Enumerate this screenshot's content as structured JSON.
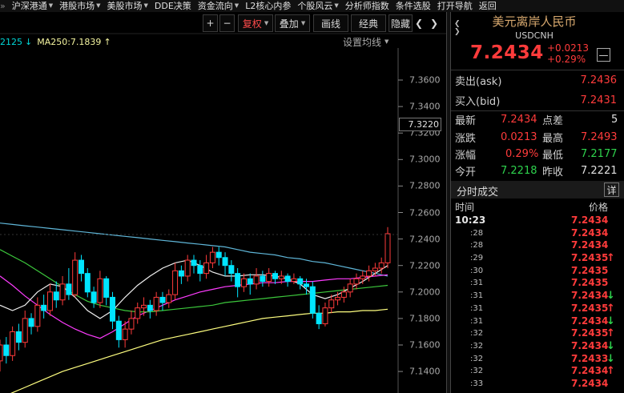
{
  "menu": [
    {
      "label": "沪深港通",
      "dropdown": true
    },
    {
      "label": "港股市场",
      "dropdown": true
    },
    {
      "label": "美股市场",
      "dropdown": true
    },
    {
      "label": "DDE决策",
      "dropdown": false
    },
    {
      "label": "资金流向",
      "dropdown": true
    },
    {
      "label": "L2核心内参",
      "dropdown": false
    },
    {
      "label": "个股风云",
      "dropdown": true
    },
    {
      "label": "分析师指数",
      "dropdown": false
    },
    {
      "label": "条件选股",
      "dropdown": false
    },
    {
      "label": "打开导航",
      "dropdown": false
    },
    {
      "label": "返回",
      "dropdown": false
    }
  ],
  "toolbar": {
    "plus": "+",
    "minus": "−",
    "fuquan": "复权",
    "diejia": "叠加",
    "huaxian": "画线",
    "jingdian": "经典",
    "yincang": "隐藏",
    "prev": "❮",
    "next": "❯"
  },
  "ma_legend": {
    "ma_a": "2125",
    "ma_b": "MA250:7.1839",
    "settings": "设置均线"
  },
  "axis": {
    "ticks": [
      "7.3600",
      "7.3400",
      "7.3200",
      "7.3000",
      "7.2800",
      "7.2600",
      "7.2400",
      "7.2200",
      "7.2000",
      "7.1800",
      "7.1600",
      "7.1400"
    ],
    "current": "7.3220"
  },
  "panel": {
    "title": "美元离岸人民币",
    "code": "USDCNH",
    "price": "7.2434",
    "change": "+0.0213",
    "change_pct": "+0.29%",
    "ask_label": "卖出(ask)",
    "ask": "7.2436",
    "bid_label": "买入(bid)",
    "bid": "7.2431",
    "quote": {
      "latest_label": "最新",
      "latest": "7.2434",
      "spread_label": "点差",
      "spread": "5",
      "change_label": "涨跌",
      "change": "0.0213",
      "high_label": "最高",
      "high": "7.2493",
      "pct_label": "涨幅",
      "pct": "0.29%",
      "low_label": "最低",
      "low": "7.2177",
      "open_label": "今开",
      "open": "7.2218",
      "prev_label": "昨收",
      "prev": "7.2221"
    },
    "trade_title": "分时成交",
    "detail_btn": "详",
    "col_time": "时间",
    "col_price": "价格",
    "trades": [
      {
        "time": "10:23",
        "price": "7.2434",
        "dir": ""
      },
      {
        "time": ":28",
        "price": "7.2434",
        "dir": ""
      },
      {
        "time": ":28",
        "price": "7.2434",
        "dir": ""
      },
      {
        "time": ":29",
        "price": "7.2435",
        "dir": "up"
      },
      {
        "time": ":30",
        "price": "7.2435",
        "dir": ""
      },
      {
        "time": ":31",
        "price": "7.2435",
        "dir": ""
      },
      {
        "time": ":31",
        "price": "7.2434",
        "dir": "down"
      },
      {
        "time": ":31",
        "price": "7.2435",
        "dir": "up"
      },
      {
        "time": ":31",
        "price": "7.2434",
        "dir": "down"
      },
      {
        "time": ":32",
        "price": "7.2435",
        "dir": "up"
      },
      {
        "time": ":32",
        "price": "7.2434",
        "dir": "down"
      },
      {
        "time": ":32",
        "price": "7.2433",
        "dir": "down"
      },
      {
        "time": ":32",
        "price": "7.2434",
        "dir": "up"
      },
      {
        "time": ":33",
        "price": "7.2434",
        "dir": ""
      }
    ]
  },
  "colors": {
    "up": "#ff3b3b",
    "down": "#00e5ff",
    "ma_cyan": "#5fb6d8",
    "ma_yellow": "#ffff80",
    "ma_magenta": "#ff3cff",
    "ma_green": "#3cc83c",
    "ma_white": "#f0f0f0"
  },
  "chart_data": {
    "type": "candlestick",
    "ylim": [
      7.13,
      7.37
    ],
    "candles": [
      [
        7.148,
        7.16,
        7.14,
        7.164
      ],
      [
        7.16,
        7.152,
        7.146,
        7.166
      ],
      [
        7.152,
        7.17,
        7.148,
        7.174
      ],
      [
        7.17,
        7.162,
        7.156,
        7.176
      ],
      [
        7.162,
        7.18,
        7.158,
        7.186
      ],
      [
        7.18,
        7.174,
        7.168,
        7.184
      ],
      [
        7.174,
        7.19,
        7.17,
        7.196
      ],
      [
        7.19,
        7.186,
        7.18,
        7.198
      ],
      [
        7.186,
        7.2,
        7.182,
        7.206
      ],
      [
        7.2,
        7.194,
        7.188,
        7.208
      ],
      [
        7.194,
        7.206,
        7.19,
        7.212
      ],
      [
        7.206,
        7.198,
        7.194,
        7.218
      ],
      [
        7.198,
        7.224,
        7.196,
        7.23
      ],
      [
        7.224,
        7.214,
        7.208,
        7.228
      ],
      [
        7.214,
        7.2,
        7.196,
        7.218
      ],
      [
        7.2,
        7.192,
        7.188,
        7.204
      ],
      [
        7.192,
        7.21,
        7.188,
        7.216
      ],
      [
        7.21,
        7.196,
        7.19,
        7.212
      ],
      [
        7.196,
        7.178,
        7.172,
        7.2
      ],
      [
        7.178,
        7.164,
        7.158,
        7.182
      ],
      [
        7.164,
        7.172,
        7.158,
        7.178
      ],
      [
        7.172,
        7.18,
        7.168,
        7.186
      ],
      [
        7.18,
        7.188,
        7.176,
        7.192
      ],
      [
        7.188,
        7.19,
        7.182,
        7.196
      ],
      [
        7.19,
        7.186,
        7.18,
        7.194
      ],
      [
        7.186,
        7.196,
        7.182,
        7.2
      ],
      [
        7.196,
        7.192,
        7.186,
        7.2
      ],
      [
        7.192,
        7.198,
        7.188,
        7.202
      ],
      [
        7.198,
        7.216,
        7.194,
        7.222
      ],
      [
        7.216,
        7.212,
        7.206,
        7.22
      ],
      [
        7.212,
        7.224,
        7.208,
        7.228
      ],
      [
        7.224,
        7.22,
        7.214,
        7.228
      ],
      [
        7.22,
        7.214,
        7.208,
        7.224
      ],
      [
        7.214,
        7.222,
        7.21,
        7.228
      ],
      [
        7.222,
        7.23,
        7.218,
        7.234
      ],
      [
        7.23,
        7.226,
        7.22,
        7.234
      ],
      [
        7.226,
        7.22,
        7.212,
        7.23
      ],
      [
        7.22,
        7.214,
        7.208,
        7.224
      ],
      [
        7.214,
        7.204,
        7.196,
        7.218
      ],
      [
        7.204,
        7.21,
        7.2,
        7.214
      ],
      [
        7.21,
        7.206,
        7.198,
        7.214
      ],
      [
        7.206,
        7.212,
        7.202,
        7.218
      ],
      [
        7.212,
        7.208,
        7.204,
        7.216
      ],
      [
        7.208,
        7.214,
        7.204,
        7.218
      ],
      [
        7.214,
        7.21,
        7.206,
        7.216
      ],
      [
        7.21,
        7.212,
        7.206,
        7.216
      ],
      [
        7.212,
        7.208,
        7.204,
        7.214
      ],
      [
        7.208,
        7.21,
        7.206,
        7.214
      ],
      [
        7.21,
        7.206,
        7.202,
        7.212
      ],
      [
        7.206,
        7.204,
        7.198,
        7.21
      ],
      [
        7.204,
        7.184,
        7.18,
        7.208
      ],
      [
        7.184,
        7.176,
        7.172,
        7.19
      ],
      [
        7.176,
        7.188,
        7.174,
        7.192
      ],
      [
        7.188,
        7.194,
        7.184,
        7.198
      ],
      [
        7.194,
        7.196,
        7.19,
        7.2
      ],
      [
        7.196,
        7.2,
        7.192,
        7.204
      ],
      [
        7.2,
        7.206,
        7.196,
        7.21
      ],
      [
        7.206,
        7.21,
        7.202,
        7.214
      ],
      [
        7.21,
        7.212,
        7.206,
        7.216
      ],
      [
        7.212,
        7.216,
        7.208,
        7.22
      ],
      [
        7.216,
        7.218,
        7.212,
        7.222
      ],
      [
        7.218,
        7.222,
        7.214,
        7.226
      ],
      [
        7.222,
        7.244,
        7.218,
        7.249
      ]
    ],
    "candle_format": "[open, close, low, high]",
    "ma_lines": [
      {
        "name": "cyan",
        "values": [
          7.252,
          7.251,
          7.25,
          7.249,
          7.248,
          7.247,
          7.246,
          7.245,
          7.244,
          7.243,
          7.242,
          7.241,
          7.24,
          7.239,
          7.238,
          7.237,
          7.236,
          7.235,
          7.234,
          7.232,
          7.23,
          7.229,
          7.228,
          7.226,
          7.225,
          7.223,
          7.222,
          7.22,
          7.218,
          7.216,
          7.214,
          7.212
        ]
      },
      {
        "name": "magenta",
        "values": [
          7.212,
          7.205,
          7.197,
          7.19,
          7.183,
          7.177,
          7.172,
          7.168,
          7.165,
          7.17,
          7.176,
          7.182,
          7.186,
          7.19,
          7.194,
          7.197,
          7.2,
          7.202,
          7.204,
          7.205,
          7.206,
          7.207,
          7.207,
          7.208,
          7.208,
          7.208,
          7.209,
          7.21,
          7.21,
          7.211,
          7.212,
          7.213
        ]
      },
      {
        "name": "green",
        "values": [
          7.232,
          7.227,
          7.222,
          7.216,
          7.21,
          7.204,
          7.198,
          7.193,
          7.19,
          7.188,
          7.186,
          7.185,
          7.185,
          7.186,
          7.187,
          7.188,
          7.189,
          7.19,
          7.192,
          7.193,
          7.194,
          7.195,
          7.196,
          7.197,
          7.198,
          7.199,
          7.2,
          7.201,
          7.202,
          7.203,
          7.204,
          7.205
        ]
      },
      {
        "name": "yellow",
        "values": [
          7.12,
          7.124,
          7.128,
          7.132,
          7.136,
          7.14,
          7.143,
          7.146,
          7.149,
          7.152,
          7.155,
          7.158,
          7.161,
          7.164,
          7.166,
          7.168,
          7.17,
          7.172,
          7.174,
          7.176,
          7.178,
          7.18,
          7.181,
          7.182,
          7.183,
          7.184,
          7.184,
          7.185,
          7.185,
          7.186,
          7.186,
          7.187
        ]
      },
      {
        "name": "white",
        "values": [
          7.19,
          7.186,
          7.19,
          7.2,
          7.206,
          7.204,
          7.196,
          7.186,
          7.18,
          7.186,
          7.196,
          7.205,
          7.212,
          7.218,
          7.222,
          7.224,
          7.22,
          7.215,
          7.212,
          7.212,
          7.213,
          7.213,
          7.212,
          7.21,
          7.206,
          7.198,
          7.195,
          7.198,
          7.203,
          7.208,
          7.214,
          7.22
        ]
      }
    ]
  }
}
